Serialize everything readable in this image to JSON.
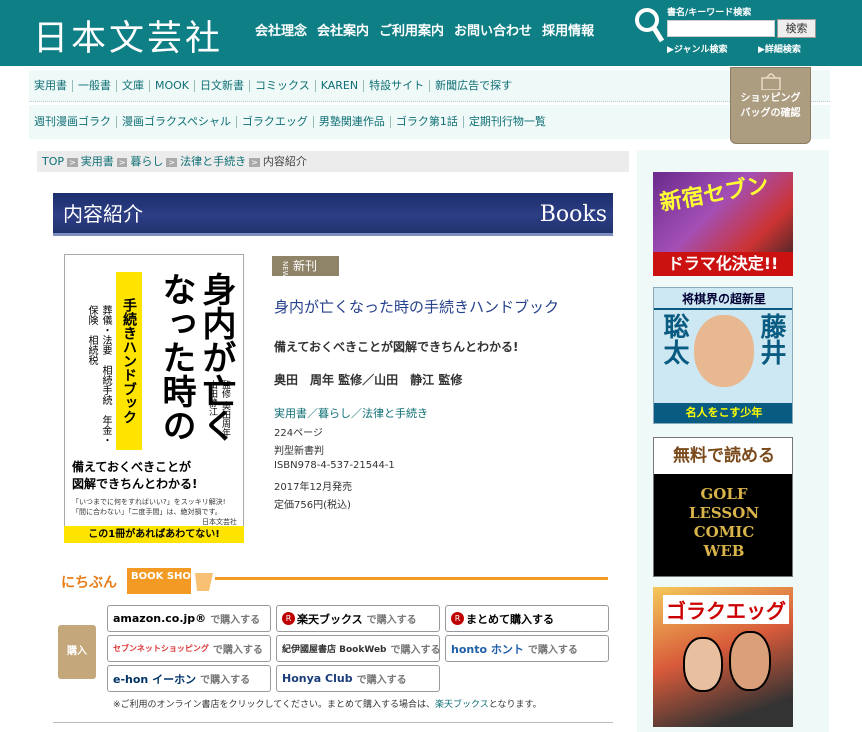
{
  "header": {
    "logo": "日本文芸社",
    "nav": [
      "会社理念",
      "会社案内",
      "ご利用案内",
      "お問い合わせ",
      "採用情報"
    ],
    "search_label": "書名/キーワード検索",
    "search_button": "検索",
    "genre_search": "▶ジャンル検索",
    "advanced_search": "▶詳細検索",
    "accent": "#0f7f86"
  },
  "nav1": [
    "実用書",
    "一般書",
    "文庫",
    "MOOK",
    "日文新書",
    "コミックス",
    "KAREN",
    "特設サイト",
    "新聞広告で探す"
  ],
  "nav2": [
    "週刊漫画ゴラク",
    "漫画ゴラクスペシャル",
    "ゴラクエッグ",
    "男塾関連作品",
    "ゴラク第1話",
    "定期刊行物一覧"
  ],
  "cart": {
    "line1": "ショッピング",
    "line2": "バッグの確認"
  },
  "breadcrumb": {
    "top": "TOP",
    "c1": "実用書",
    "c2": "暮らし",
    "c3": "法律と手続き",
    "current": "内容紹介"
  },
  "banner": {
    "title": "内容紹介",
    "books": "Books"
  },
  "cover": {
    "title": "身内が亡くなった時の",
    "subtitle": "手続きハンドブック",
    "left": "葬儀・法要　相続手続　年金・保険　相続税",
    "authors": "監修 奥田周年　山田静江",
    "tagline_1": "備えておくべきことが",
    "tagline_2": "図解できちんとわかる!",
    "small_1": "「いつまでに何をすればいい?」をスッキリ解決!",
    "small_2": "「間に合わない」「二度手間」は、絶対損です。",
    "small_3": "日本文芸社",
    "bar": "この1冊があればあわてない!"
  },
  "book": {
    "new_label": "新刊",
    "new_en": "NEW",
    "title": "身内が亡くなった時の手続きハンドブック",
    "catch": "備えておくべきことが図解できちんとわかる!",
    "authors": "奥田　周年 監修／山田　静江 監修",
    "categories": "実用書／暮らし／法律と手続き",
    "pages": "224ページ",
    "format": "判型新書判",
    "isbn": "ISBN978-4-537-21544-1",
    "date": "2017年12月発売",
    "price": "定価756円(税込)"
  },
  "shop": {
    "title_1": "にちぶん",
    "title_2": "BOOK SHOP",
    "bag": "購入",
    "buy_suffix": "で購入する",
    "buttons": [
      {
        "name": "amazon",
        "logo": "amazon.co.jp®"
      },
      {
        "name": "rakuten",
        "logo": "楽天ブックス"
      },
      {
        "name": "matomete",
        "logo": "まとめて購入する"
      },
      {
        "name": "7net",
        "logo": "セブンネットショッピング"
      },
      {
        "name": "kinokuniya",
        "logo": "紀伊國屋書店 BookWeb"
      },
      {
        "name": "honto",
        "logo": "honto ホント"
      },
      {
        "name": "ehon",
        "logo": "e-hon イーホン"
      },
      {
        "name": "honyaclub",
        "logo": "Honya Club"
      }
    ],
    "note_1": "※ご利用のオンライン書店をクリックしてください。まとめて購入する場合は、",
    "note_link": "楽天ブックス",
    "note_2": "となります。"
  },
  "ads": {
    "ad1_title": "新宿セブン",
    "ad1_sub": "ドラマ化決定!!",
    "ad2_top": "将棋界の超新星",
    "ad2_left": "聡太",
    "ad2_right": "藤井",
    "ad2_bot": "名人をこす少年",
    "ad3_top": "無料で読める",
    "ad3_lines": [
      "GOLF",
      "LESSON",
      "COMIC",
      "WEB"
    ],
    "ad4_title": "ゴラクエッグ"
  }
}
